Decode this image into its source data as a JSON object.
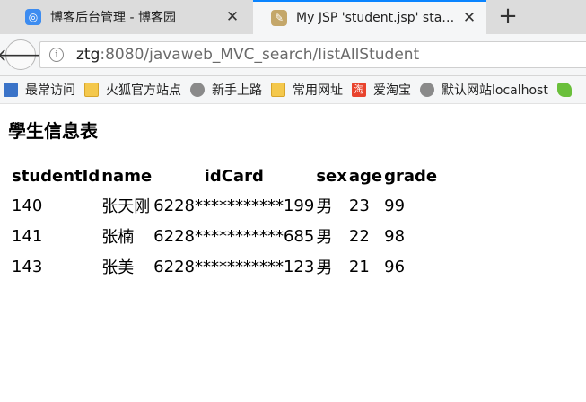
{
  "browser": {
    "tabs": [
      {
        "title": "博客后台管理 - 博客园",
        "active": false
      },
      {
        "title": "My JSP 'student.jsp' sta…",
        "active": true
      }
    ],
    "new_tab_label": "+",
    "close_label": "✕",
    "url_host": "ztg",
    "url_rest": ":8080/javaweb_MVC_search/listAllStudent",
    "bookmarks": [
      {
        "label": "最常访问",
        "icon": "visit-icon"
      },
      {
        "label": "火狐官方站点",
        "icon": "folder-icon"
      },
      {
        "label": "新手上路",
        "icon": "globe-icon"
      },
      {
        "label": "常用网址",
        "icon": "folder-icon"
      },
      {
        "label": "爱淘宝",
        "icon": "taobao-icon"
      },
      {
        "label": "默认网站localhost",
        "icon": "globe-icon"
      }
    ],
    "accent_color": "#0a84ff"
  },
  "page": {
    "title": "學生信息表",
    "table": {
      "headers": [
        "studentId",
        "name",
        "idCard",
        "sex",
        "age",
        "grade"
      ],
      "rows": [
        [
          "140",
          "张天刚",
          "6228***********199",
          "男",
          "23",
          "99"
        ],
        [
          "141",
          "张楠",
          "6228***********685",
          "男",
          "22",
          "98"
        ],
        [
          "143",
          "张美",
          "6228***********123",
          "男",
          "21",
          "96"
        ]
      ]
    }
  }
}
